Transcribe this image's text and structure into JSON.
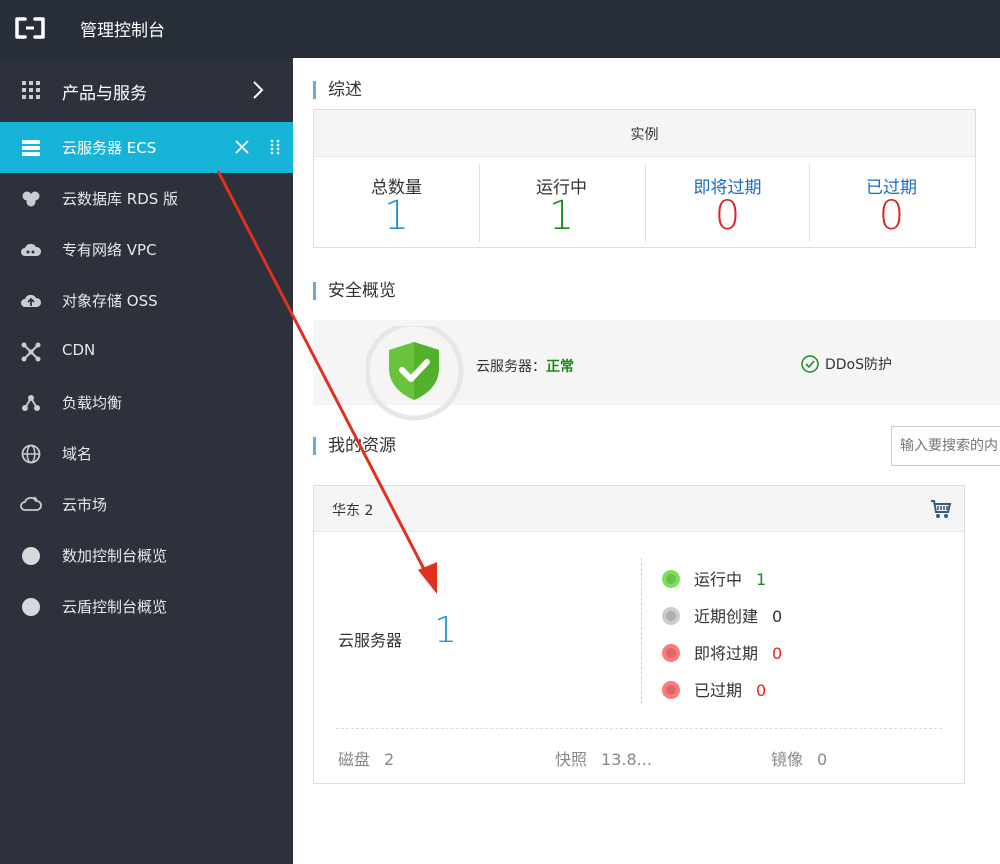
{
  "topbar": {
    "title": "管理控制台"
  },
  "sidebar": {
    "products_label": "产品与服务",
    "items": [
      {
        "label": "云服务器 ECS",
        "icon": "server-icon",
        "active": true
      },
      {
        "label": "云数据库 RDS 版",
        "icon": "database-icon"
      },
      {
        "label": "专有网络 VPC",
        "icon": "cloud-network-icon"
      },
      {
        "label": "对象存储 OSS",
        "icon": "cloud-storage-icon"
      },
      {
        "label": "CDN",
        "icon": "cdn-icon"
      },
      {
        "label": "负载均衡",
        "icon": "load-balancer-icon"
      },
      {
        "label": "域名",
        "icon": "globe-icon"
      },
      {
        "label": "云市场",
        "icon": "market-icon"
      },
      {
        "label": "数加控制台概览",
        "icon": "circle-icon"
      },
      {
        "label": "云盾控制台概览",
        "icon": "circle-icon"
      }
    ]
  },
  "overview": {
    "title": "综述",
    "header": "实例",
    "cells": [
      {
        "label": "总数量",
        "value": "1"
      },
      {
        "label": "运行中",
        "value": "1"
      },
      {
        "label": "即将过期",
        "value": "0"
      },
      {
        "label": "已过期",
        "value": "0"
      }
    ]
  },
  "security": {
    "title": "安全概览",
    "server_label": "云服务器：",
    "server_status": "正常",
    "ddos_label": "DDoS防护"
  },
  "resources": {
    "title": "我的资源",
    "search_placeholder": "输入要搜索的内",
    "region": "华东 2",
    "ecs_label": "云服务器",
    "ecs_count": "1",
    "stats": [
      {
        "label": "运行中",
        "value": "1"
      },
      {
        "label": "近期创建",
        "value": "0"
      },
      {
        "label": "即将过期",
        "value": "0"
      },
      {
        "label": "已过期",
        "value": "0"
      }
    ],
    "footer": [
      {
        "label": "磁盘",
        "value": "2"
      },
      {
        "label": "快照",
        "value": "13.8..."
      },
      {
        "label": "镜像",
        "value": "0"
      }
    ]
  },
  "colors": {
    "accent": "#18b4d8",
    "blue_value": "#2591d4",
    "green_value": "#1a8a1a",
    "red_value": "#e02020",
    "dot_green": "#52c41a",
    "dot_gray": "#bbbbbb",
    "dot_red": "#ee2b2b"
  }
}
